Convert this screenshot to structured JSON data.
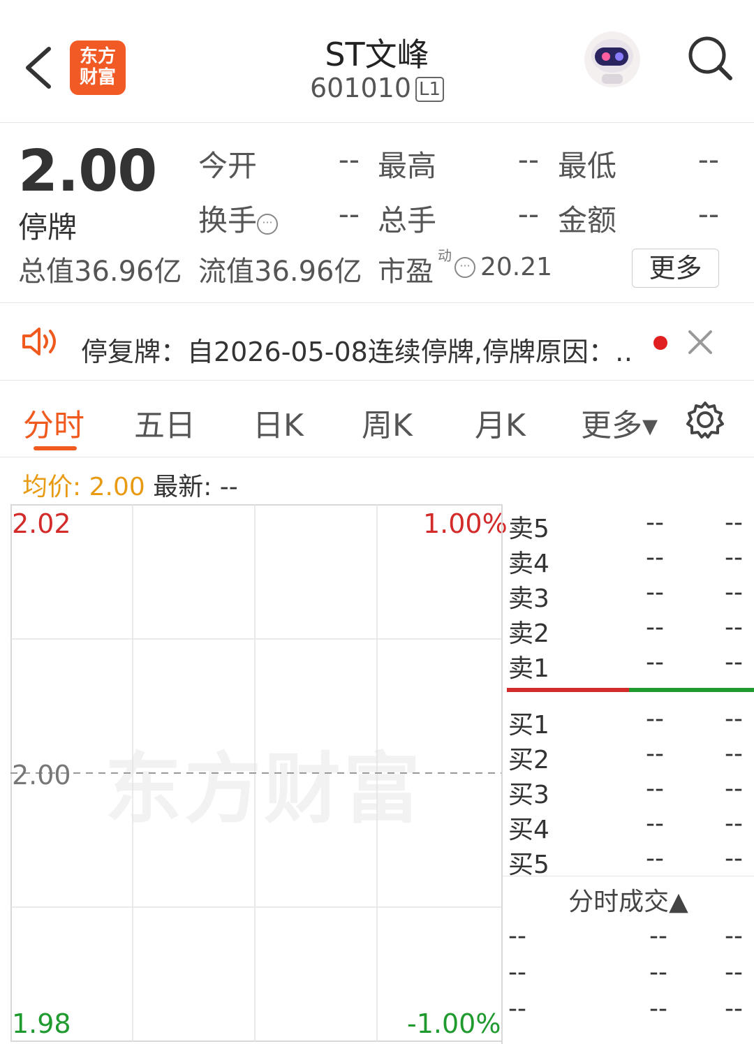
{
  "header": {
    "logo_line1": "东方",
    "logo_line2": "财富",
    "stock_name": "ST文峰",
    "stock_code": "601010",
    "level": "L1"
  },
  "quote": {
    "price": "2.00",
    "status": "停牌",
    "open_label": "今开",
    "open_value": "--",
    "high_label": "最高",
    "high_value": "--",
    "low_label": "最低",
    "low_value": "--",
    "turnover_label": "换手",
    "turnover_value": "--",
    "volume_label": "总手",
    "volume_value": "--",
    "amount_label": "金额",
    "amount_value": "--",
    "total_cap": "总值36.96亿",
    "float_cap": "流值36.96亿",
    "pe_label": "市盈",
    "pe_sup": "动",
    "pe_value": "20.21",
    "more_label": "更多"
  },
  "notice": {
    "text": "停复牌：自2026-05-08连续停牌,停牌原因：…"
  },
  "tabs": {
    "items": [
      "分时",
      "五日",
      "日K",
      "周K",
      "月K",
      "更多▾"
    ],
    "active": 0
  },
  "avg_line": {
    "avg_label": "均价:",
    "avg_value": "2.00",
    "latest_label": "最新:",
    "latest_value": "--"
  },
  "chart": {
    "watermark": "东方财富",
    "y_top": "2.02",
    "y_mid": "2.00",
    "y_bottom": "1.98",
    "pct_top": "1.00%",
    "pct_bottom": "-1.00%"
  },
  "chart_data": {
    "type": "line",
    "ylim": [
      1.98,
      2.02
    ],
    "reference_price": 2.0,
    "pct_range": [
      -1.0,
      1.0
    ],
    "series": []
  },
  "order_book": {
    "asks": [
      {
        "label": "卖5",
        "price": "--",
        "volume": "--"
      },
      {
        "label": "卖4",
        "price": "--",
        "volume": "--"
      },
      {
        "label": "卖3",
        "price": "--",
        "volume": "--"
      },
      {
        "label": "卖2",
        "price": "--",
        "volume": "--"
      },
      {
        "label": "卖1",
        "price": "--",
        "volume": "--"
      }
    ],
    "bids": [
      {
        "label": "买1",
        "price": "--",
        "volume": "--"
      },
      {
        "label": "买2",
        "price": "--",
        "volume": "--"
      },
      {
        "label": "买3",
        "price": "--",
        "volume": "--"
      },
      {
        "label": "买4",
        "price": "--",
        "volume": "--"
      },
      {
        "label": "买5",
        "price": "--",
        "volume": "--"
      }
    ],
    "trade_title": "分时成交▲",
    "trades": [
      {
        "time": "--",
        "price": "--",
        "volume": "--"
      },
      {
        "time": "--",
        "price": "--",
        "volume": "--"
      },
      {
        "time": "--",
        "price": "--",
        "volume": "--"
      }
    ]
  },
  "colors": {
    "accent": "#f05a1e",
    "up": "#d32a2a",
    "down": "#1e9a2e",
    "avg": "#e89b12"
  }
}
